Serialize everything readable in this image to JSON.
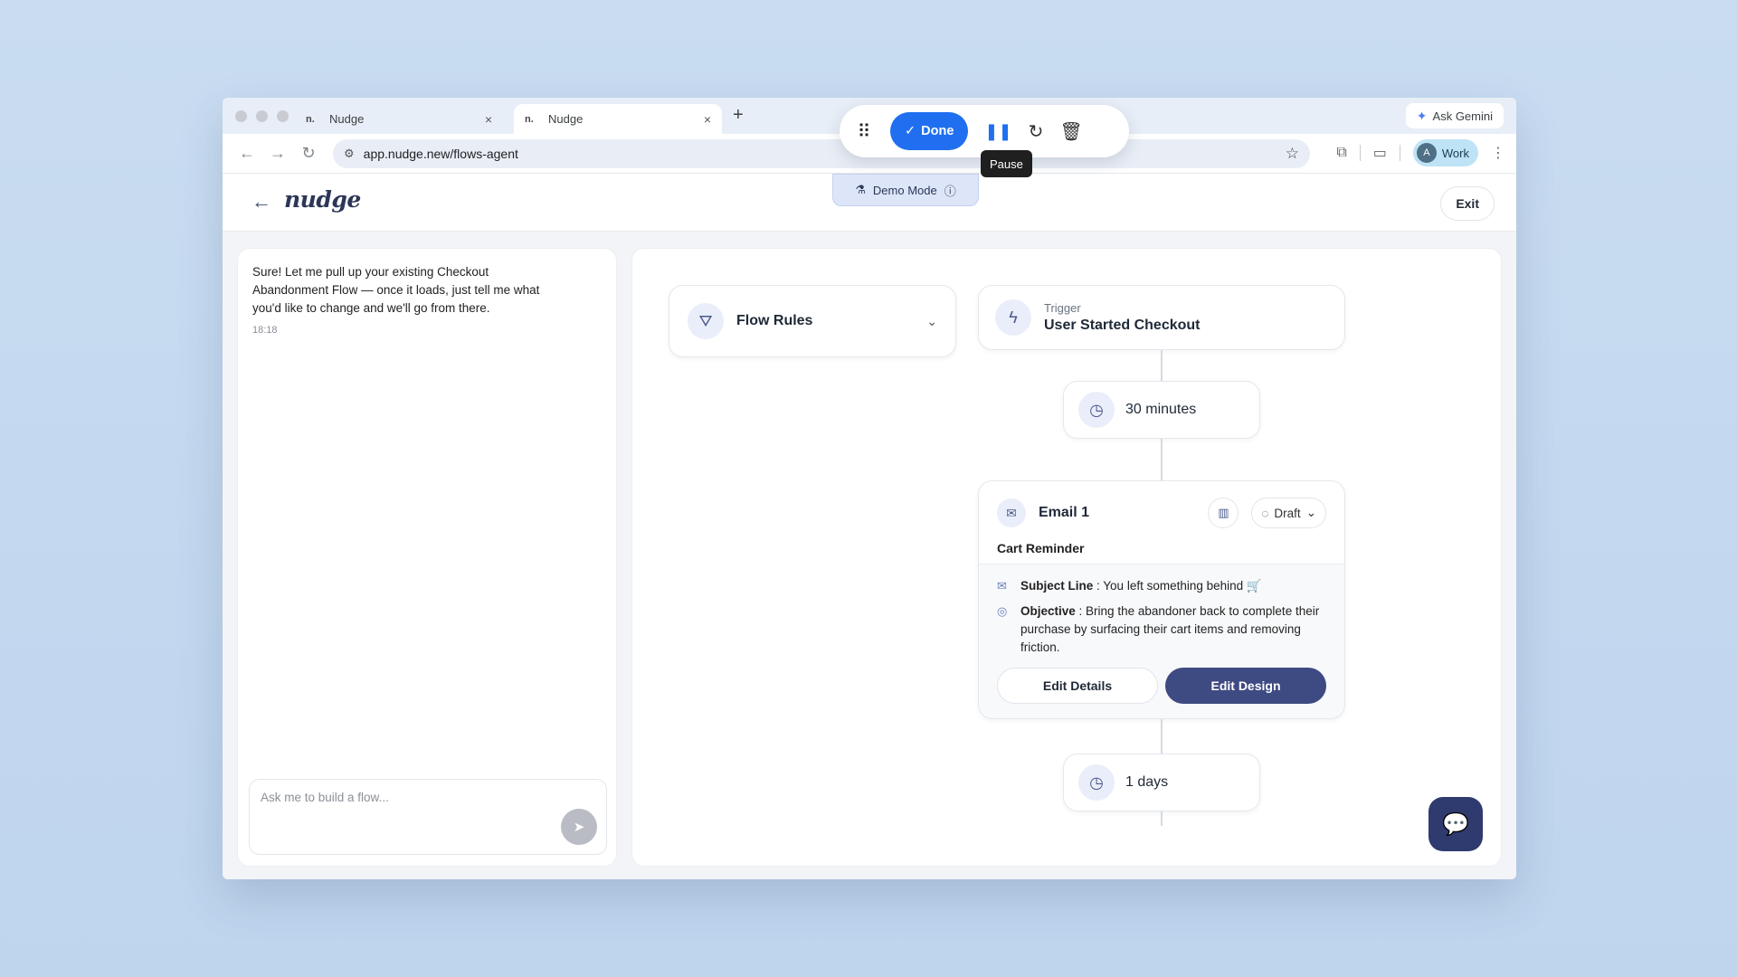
{
  "browser": {
    "tabs": [
      {
        "favicon": "n.",
        "title": "Nudge"
      },
      {
        "favicon": "n.",
        "title": "Nudge"
      }
    ],
    "new_tab": "+",
    "close_glyph": "×",
    "ask_gemini": "Ask Gemini",
    "url": "app.nudge.new/flows-agent",
    "profile_initial": "A",
    "profile_label": "Work"
  },
  "recorder": {
    "done_label": "Done",
    "tooltip": "Pause"
  },
  "demo_mode": "Demo Mode",
  "app": {
    "logo": "nudge",
    "exit_label": "Exit",
    "chat": {
      "message": "Sure! Let me pull up your existing Checkout Abandonment Flow — once it loads, just tell me what you'd like to change and we'll go from there.",
      "time": "18:18",
      "placeholder": "Ask me to build a flow..."
    },
    "flow": {
      "rules_label": "Flow Rules",
      "trigger_small": "Trigger",
      "trigger_name": "User Started Checkout",
      "delay1": "30 minutes",
      "email": {
        "title": "Email 1",
        "status": "Draft",
        "subtitle": "Cart Reminder",
        "subject_key": "Subject Line",
        "subject_value": "You left something behind 🛒",
        "objective_key": "Objective",
        "objective_value": "Bring the abandoner back to complete their purchase by surfacing their cart items and removing friction.",
        "edit_details": "Edit Details",
        "edit_design": "Edit Design"
      },
      "delay2": "1 days"
    }
  },
  "colors": {
    "accent_blue": "#1f6ff0",
    "primary_navy": "#3e4a82"
  }
}
